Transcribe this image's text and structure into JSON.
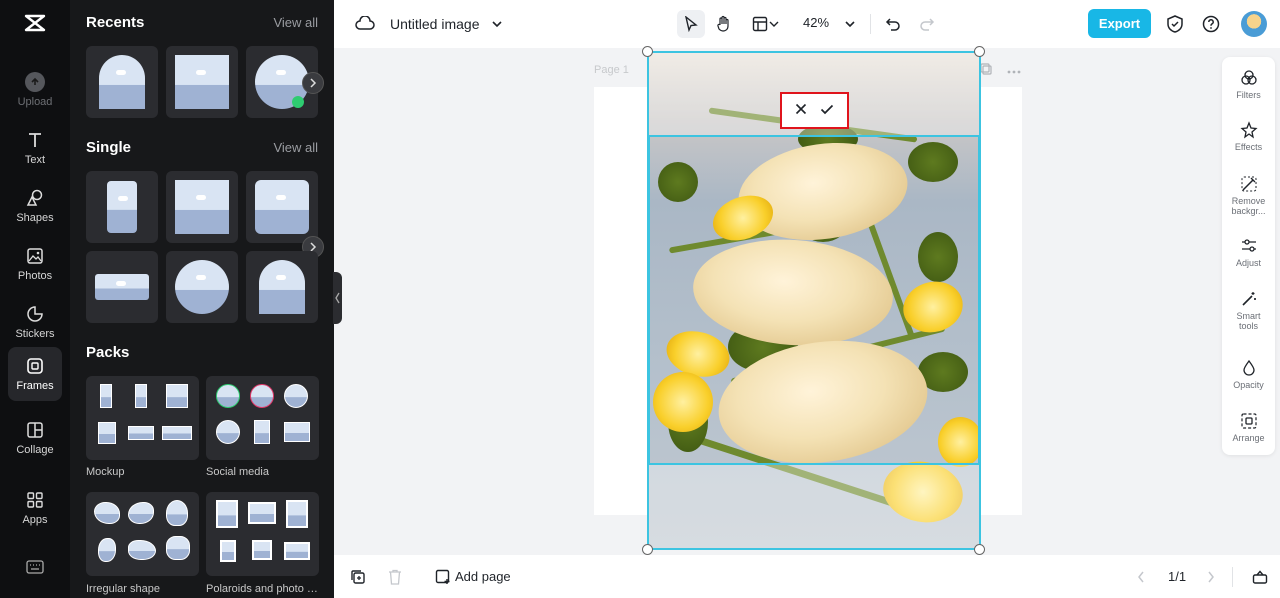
{
  "rail": {
    "items": [
      {
        "id": "upload",
        "label": "Upload"
      },
      {
        "id": "text",
        "label": "Text"
      },
      {
        "id": "shapes",
        "label": "Shapes"
      },
      {
        "id": "photos",
        "label": "Photos"
      },
      {
        "id": "stickers",
        "label": "Stickers"
      },
      {
        "id": "frames",
        "label": "Frames"
      },
      {
        "id": "collage",
        "label": "Collage"
      },
      {
        "id": "apps",
        "label": "Apps"
      }
    ]
  },
  "panel": {
    "recents": {
      "title": "Recents",
      "view_all": "View all"
    },
    "single": {
      "title": "Single",
      "view_all": "View all"
    },
    "packs": {
      "title": "Packs",
      "items": [
        {
          "label": "Mockup"
        },
        {
          "label": "Social media"
        },
        {
          "label": "Irregular shape"
        },
        {
          "label": "Polaroids and photo f..."
        }
      ]
    }
  },
  "topbar": {
    "title": "Untitled image",
    "zoom": "42%",
    "export_label": "Export"
  },
  "canvas": {
    "page_label": "Page 1"
  },
  "right_panel": {
    "items": [
      {
        "label": "Filters"
      },
      {
        "label": "Effects"
      },
      {
        "label": "Remove backgr..."
      },
      {
        "label": "Adjust"
      },
      {
        "label": "Smart tools"
      },
      {
        "label": "Opacity"
      },
      {
        "label": "Arrange"
      }
    ]
  },
  "bottombar": {
    "add_page": "Add page",
    "page_count": "1/1"
  },
  "colors": {
    "accent": "#18b7e6",
    "selection": "#3cc4e1",
    "confirm_border": "#e0141c"
  }
}
